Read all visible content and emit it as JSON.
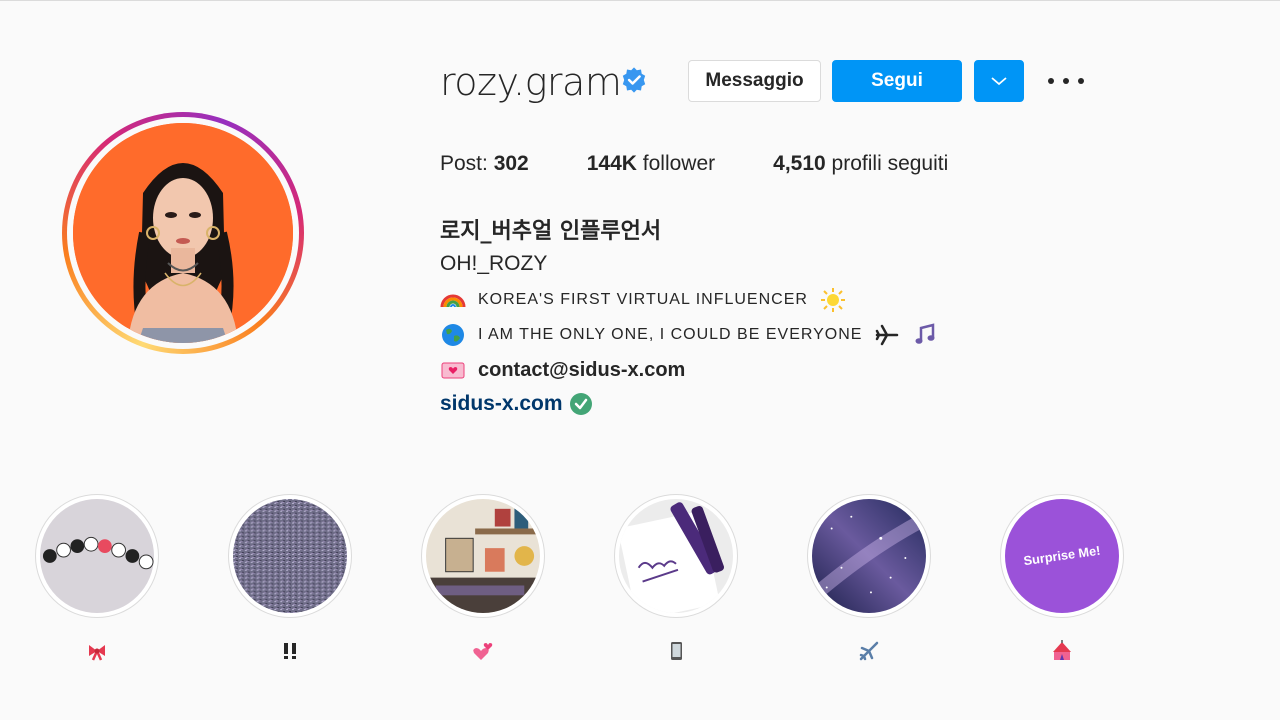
{
  "profile": {
    "username": "rozy.gram",
    "verified": true,
    "buttons": {
      "message": "Messaggio",
      "follow": "Segui"
    },
    "stats": {
      "posts_label": "Post: ",
      "posts_value": "302",
      "followers_value": "144K",
      "followers_label": " follower",
      "following_value": "4,510",
      "following_label": " profili seguiti"
    },
    "bio": {
      "full_name": "로지_버추얼 인플루언서",
      "category": "OH!_ROZY",
      "line1": "KOREA'S FIRST VIRTUAL INFLUENCER",
      "line2": "I AM THE ONLY ONE, I COULD BE EVERYONE",
      "line3": "contact@sidus-x.com",
      "website": "sidus-x.com"
    }
  },
  "highlights": [
    {
      "label": "🎀",
      "icon": "ribbon-icon",
      "theme": "rozy-beads"
    },
    {
      "label": "‼",
      "icon": "double-exclamation-icon",
      "theme": "tv-static"
    },
    {
      "label": "💕",
      "icon": "two-hearts-icon",
      "theme": "shelf-room"
    },
    {
      "label": "📱",
      "icon": "phone-icon",
      "theme": "rozy-notebook"
    },
    {
      "label": "✈️",
      "icon": "airplane-icon",
      "theme": "galaxy"
    },
    {
      "label": "🎪",
      "icon": "circus-tent-icon",
      "theme": "surprise-me",
      "image_text": "Surprise Me!"
    }
  ],
  "colors": {
    "accent_blue": "#0095f6",
    "link": "#00376b",
    "text": "#262626",
    "avatar_bg": "#ff6a2a",
    "surprise_purple": "#9b52d9"
  }
}
